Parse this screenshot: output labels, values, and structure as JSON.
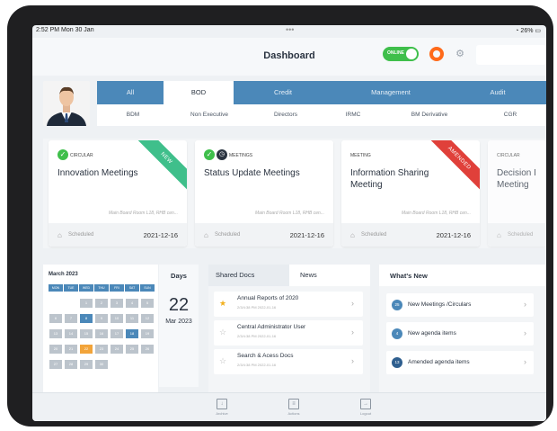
{
  "status_bar": {
    "time": "2:52 PM  Mon 30 Jan",
    "dots": "•••",
    "right": "26%"
  },
  "header": {
    "title": "Dashboard",
    "online_label": "ONLINE"
  },
  "tabs": [
    "All",
    "BOD",
    "Credit",
    "Management",
    "Audit"
  ],
  "active_tab": "BOD",
  "subtabs": [
    "BDM",
    "Non Executive",
    "Directors",
    "IRMC",
    "BM Derivative",
    "CGR"
  ],
  "cards": [
    {
      "type": "CIRCULAR",
      "title": "Innovation Meetings",
      "location": "Main Board Room L18, RHB cen...",
      "status": "Scheduled",
      "date": "2021-12-16",
      "ribbon": "NEW",
      "ribbon_color": "#3fbf8b"
    },
    {
      "type": "MEETINGS",
      "title": "Status Update Meetings",
      "location": "Main Board Room L18, RHB cen...",
      "status": "Scheduled",
      "date": "2021-12-16",
      "ribbon": "",
      "ribbon_color": ""
    },
    {
      "type": "MEETING",
      "title": "Information Sharing Meeting",
      "location": "Main Board Room L18, RHB cen...",
      "status": "Scheduled",
      "date": "2021-12-16",
      "ribbon": "AMENDED",
      "ribbon_color": "#e0403a"
    },
    {
      "type": "CIRCULAR",
      "title": "Decision I Meeting",
      "location": "",
      "status": "Scheduled",
      "date": "",
      "ribbon": "",
      "ribbon_color": ""
    }
  ],
  "calendar": {
    "month_label": "March 2023",
    "weekdays": [
      "MON",
      "TUE",
      "WED",
      "THU",
      "FRI",
      "SAT",
      "SUN"
    ],
    "days": [
      "",
      "",
      "1",
      "2",
      "3",
      "4",
      "5",
      "6",
      "7",
      "8",
      "9",
      "10",
      "11",
      "12",
      "13",
      "14",
      "15",
      "16",
      "17",
      "18",
      "19",
      "20",
      "21",
      "22",
      "23",
      "24",
      "25",
      "26",
      "27",
      "28",
      "29",
      "30",
      "",
      "",
      ""
    ],
    "selected_day": "22",
    "highlighted_days": [
      "8",
      "18"
    ]
  },
  "days_panel": {
    "title": "Days",
    "number": "22",
    "month": "Mar 2023"
  },
  "docs": {
    "tabs": [
      "Shared Docs",
      "News"
    ],
    "items": [
      {
        "name": "Annual Reports of 2020",
        "sub": "2/3/4:38 PM 2022-01-16",
        "starred": true
      },
      {
        "name": "Central Administrator User",
        "sub": "2/3/4:38 PM 2022-01-16",
        "starred": false
      },
      {
        "name": "Search & Acess Docs",
        "sub": "2/3/4:38 PM 2022-01-16",
        "starred": false
      }
    ]
  },
  "whats_new": {
    "title": "What's New",
    "items": [
      {
        "count": "25",
        "label": "New Meetings /Circulars"
      },
      {
        "count": "4",
        "label": "New agenda items"
      },
      {
        "count": "13",
        "label": "Amended agenda items"
      }
    ]
  },
  "bottom_nav": [
    "Archive",
    "Actions",
    "Logout"
  ],
  "colors": {
    "primary": "#4b88b9",
    "online": "#3fbf4b",
    "brand_orange": "#ff6a1a",
    "selected_day": "#f2a43a"
  }
}
